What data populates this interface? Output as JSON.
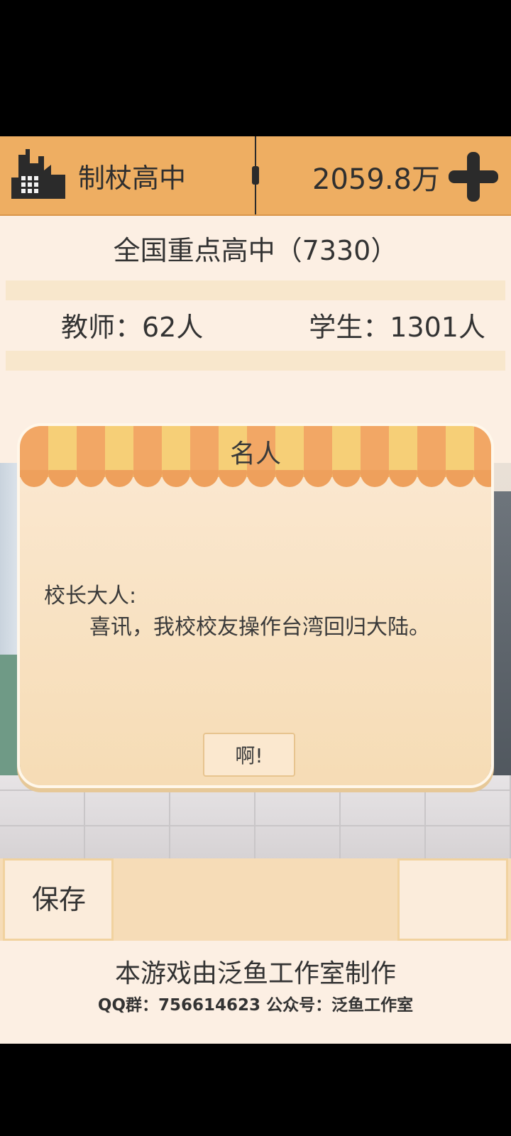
{
  "header": {
    "school_name": "制杖高中",
    "money": "2059.8万"
  },
  "info": {
    "rank_title": "全国重点高中（7330）",
    "teachers": "教师：62人",
    "students": "学生：1301人"
  },
  "popup": {
    "title": "名人",
    "salutation": "校长大人:",
    "message": "喜讯，我校校友操作台湾回归大陆。",
    "ok_label": "啊!"
  },
  "bottom": {
    "save_label": "保存"
  },
  "footer": {
    "credit": "本游戏由泛鱼工作室制作",
    "contact": "QQ群：756614623 公众号：泛鱼工作室"
  },
  "colors": {
    "topbar": "#eeae62",
    "panel": "#fcefe3",
    "awning_orange": "#f2a765",
    "awning_yellow": "#f6cf77",
    "icon_dark": "#2b2b2b"
  },
  "icons": {
    "school": "factory-building-icon",
    "add": "plus-icon"
  }
}
